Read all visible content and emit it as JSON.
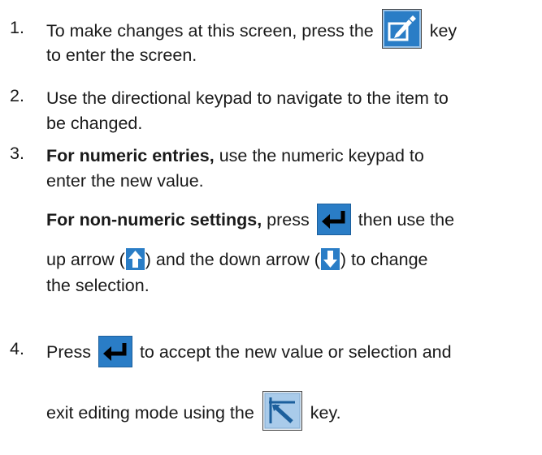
{
  "steps": [
    {
      "number": "1.",
      "line1_a": "To make changes at this screen, press the",
      "line1_b": "key",
      "line2": "to enter the screen."
    },
    {
      "number": "2.",
      "line1": "Use the directional keypad to navigate to the item to",
      "line2": "be changed."
    },
    {
      "number": "3.",
      "bold_a": "For numeric entries,",
      "line1_rest": "use the numeric keypad to",
      "line2": "enter the new value.",
      "bold_b": "For non-numeric settings,",
      "press": "press",
      "then_use": "then use the",
      "up_a": "up arrow (",
      "up_b": ") and the down arrow (",
      "up_c": ") to change",
      "last": "the selection."
    },
    {
      "number": "4.",
      "press": "Press",
      "accept": "to accept the new value or selection and",
      "exit_a": "exit editing mode using the",
      "exit_b": "key."
    }
  ],
  "icons": {
    "edit": "edit-screen-key-icon",
    "enter": "enter-key-icon",
    "up": "up-arrow-key-icon",
    "down": "down-arrow-key-icon",
    "exit": "exit-screen-key-icon"
  },
  "colors": {
    "key_blue": "#2a7dc6",
    "key_dark": "#1c5f9c",
    "text": "#1a1a1a"
  }
}
